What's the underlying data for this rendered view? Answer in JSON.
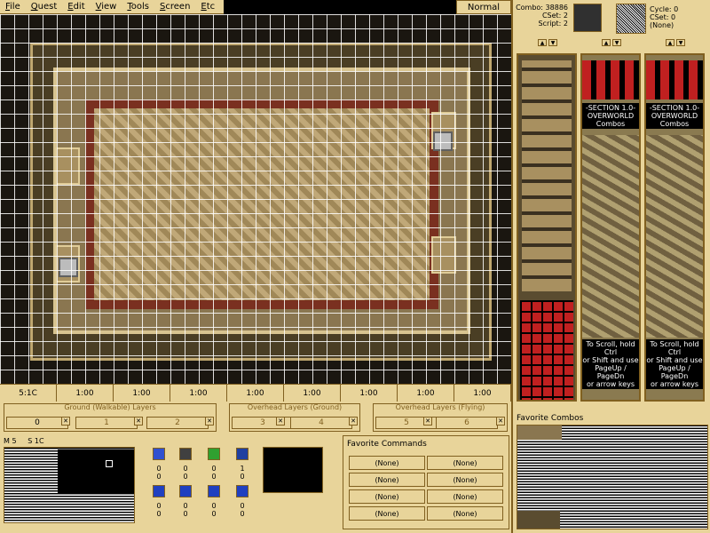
{
  "menu": [
    "File",
    "Quest",
    "Edit",
    "View",
    "Tools",
    "Screen",
    "Etc"
  ],
  "mode": "Normal",
  "combo_info": {
    "combo": "Combo: 38886",
    "cset": "CSet: 2",
    "script": "Script: 2",
    "cycle": "Cycle: 0",
    "cset2": "CSet: 0",
    "none": "(None)"
  },
  "combo_col_text": {
    "section": [
      "-SECTION 1.0-",
      "OVERWORLD",
      "Combos"
    ],
    "help": [
      "To Scroll, hold Ctrl",
      "or Shift and use",
      "PageUp / PageDn",
      "or arrow keys"
    ]
  },
  "layer_tabs": [
    "5:1C",
    "1:00",
    "1:00",
    "1:00",
    "1:00",
    "1:00",
    "1:00",
    "1:00",
    "1:00"
  ],
  "layer_groups": {
    "ground": "Ground (Walkable) Layers",
    "overhead_ground": "Overhead Layers (Ground)",
    "overhead_flying": "Overhead Layers (Flying)"
  },
  "layer_numbers": [
    "0",
    "1",
    "2",
    "3",
    "4",
    "5",
    "6"
  ],
  "minimap": {
    "label_a": "M 5",
    "label_b": "S 1C"
  },
  "items_row1": [
    {
      "icon": "blue-potion-icon",
      "color": "#3050d0",
      "v1": "0",
      "v2": "0"
    },
    {
      "icon": "stairs-icon",
      "color": "#404040",
      "v1": "0",
      "v2": "0"
    },
    {
      "icon": "green-item-icon",
      "color": "#30a030",
      "v1": "0",
      "v2": "0"
    },
    {
      "icon": "bomb-icon",
      "color": "#2040a0",
      "v1": "1",
      "v2": "0"
    }
  ],
  "items_row2": [
    {
      "icon": "a-button-icon",
      "color": "#2040c0",
      "v1": "0",
      "v2": "0"
    },
    {
      "icon": "b-button-icon",
      "color": "#2040c0",
      "v1": "0",
      "v2": "0"
    },
    {
      "icon": "c-button-icon",
      "color": "#2040c0",
      "v1": "0",
      "v2": "0"
    },
    {
      "icon": "d-button-icon",
      "color": "#2040c0",
      "v1": "0",
      "v2": "0"
    }
  ],
  "favorite_commands": {
    "title": "Favorite Commands",
    "items": [
      "(None)",
      "(None)",
      "(None)",
      "(None)",
      "(None)",
      "(None)",
      "(None)",
      "(None)"
    ]
  },
  "favorite_combos": {
    "title": "Favorite Combos"
  }
}
